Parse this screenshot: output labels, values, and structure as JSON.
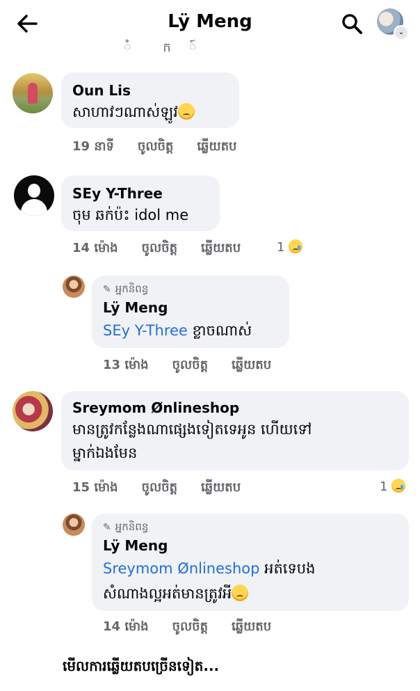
{
  "header": {
    "title": "Lÿ Meng",
    "back_icon": "arrow-left-icon",
    "search_icon": "search-icon",
    "avatar_icon": "profile-avatar-icon",
    "cut_text": "ំ ក ៍"
  },
  "comments": [
    {
      "name": "Oun Lis",
      "text": "សាហាវៗណាស់ឡូវ",
      "time": "19 នាទី",
      "like": "ចូលចិត្ត",
      "reply": "ឆ្លើយតប"
    },
    {
      "name": "SEy Y-Three",
      "text": "ចុម ឆក់ប៉ះ idol me",
      "time": "14 ម៉ោង",
      "like": "ចូលចិត្ត",
      "reply": "ឆ្លើយតប",
      "reaction_count": "1"
    },
    {
      "author_badge": "អ្នកនិពន្ធ",
      "name": "Lÿ Meng",
      "mention": "SEy Y-Three",
      "text": " ខ្លាចណាស់",
      "time": "13 ម៉ោង",
      "like": "ចូលចិត្ត",
      "reply": "ឆ្លើយតប"
    },
    {
      "name": "Sreymom Ønlineshop",
      "text_line1": "មានត្រូវកន្លែងណាផ្សេងទៀតទេអូន ហើយទៅ",
      "text_line2": "ម្នាក់ឯងមែន",
      "time": "15 ម៉ោង",
      "like": "ចូលចិត្ត",
      "reply": "ឆ្លើយតប",
      "reaction_count": "1"
    },
    {
      "author_badge": "អ្នកនិពន្ធ",
      "name": "Lÿ Meng",
      "mention": "Sreymom Ønlineshop",
      "text_line1": " អត់ទេបង",
      "text_line2": "សំណាងល្អអត់មានត្រូវអី",
      "time": "14 ម៉ោង",
      "like": "ចូលចិត្ត",
      "reply": "ឆ្លើយតប"
    }
  ],
  "footer": {
    "view_more": "មើលការឆ្លើយតបច្រើនទៀត..."
  }
}
